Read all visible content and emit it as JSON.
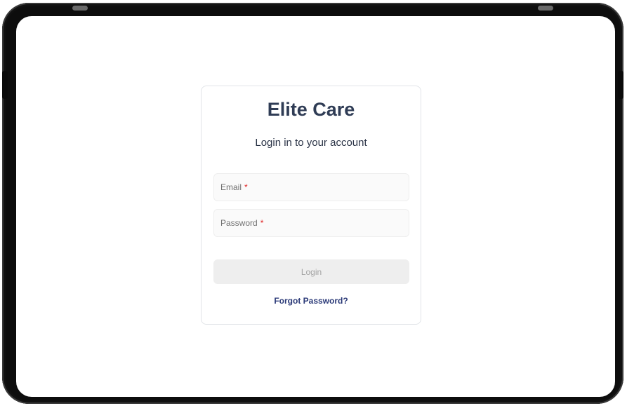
{
  "app": {
    "title": "Elite Care",
    "subtitle": "Login in to your account"
  },
  "form": {
    "email": {
      "label": "Email",
      "required_mark": "*"
    },
    "password": {
      "label": "Password",
      "required_mark": "*"
    },
    "login_label": "Login",
    "forgot_label": "Forgot Password?"
  }
}
